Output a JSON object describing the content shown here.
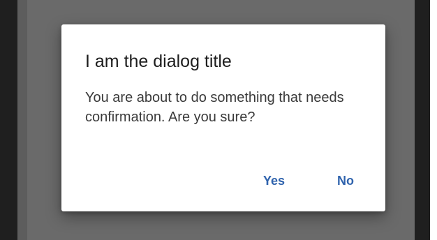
{
  "dialog": {
    "title": "I am the dialog title",
    "message": "You are about to do something that needs confirmation. Are you sure?",
    "actions": [
      {
        "label": "Yes"
      },
      {
        "label": "No"
      }
    ]
  },
  "colors": {
    "device_frame": "#1f1f1f",
    "scrim": "#6a6a6a",
    "dialog_background": "#ffffff",
    "title_text": "#1d1d1d",
    "body_text": "#3a3a3a",
    "action_text": "#2f63ad"
  }
}
